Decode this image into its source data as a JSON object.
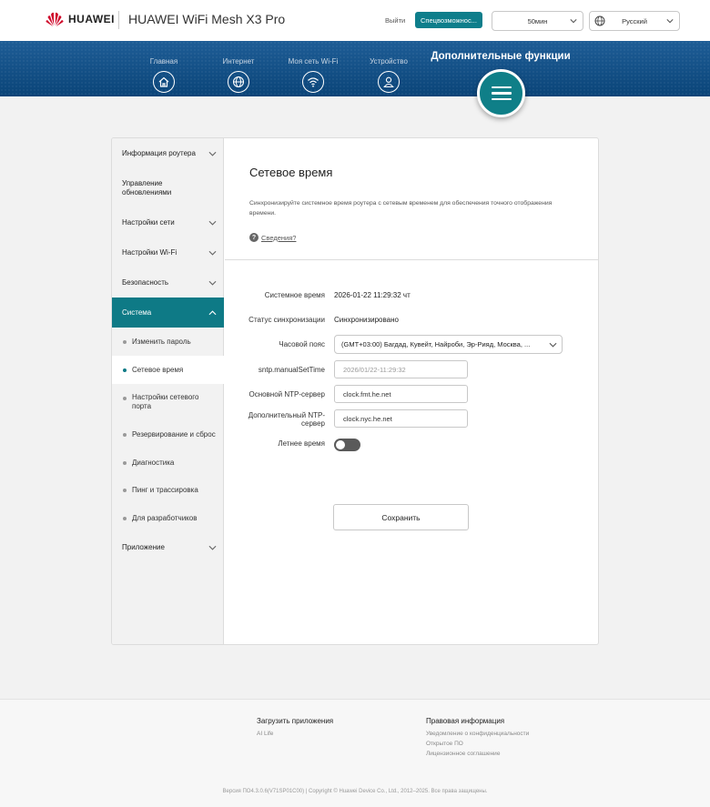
{
  "header": {
    "brand": "HUAWEI",
    "product": "HUAWEI WiFi Mesh X3 Pro",
    "logout_label": "Выйти",
    "accessibility_label": "Спецвозможнос...",
    "timeout_value": "50мин",
    "language_value": "Русский",
    "brand_color": "#cf0a2c",
    "accent_color": "#0e7e8b"
  },
  "nav": {
    "items": [
      {
        "label": "Главная",
        "icon": "home-icon"
      },
      {
        "label": "Интернет",
        "icon": "globe-icon"
      },
      {
        "label": "Моя сеть Wi-Fi",
        "icon": "wifi-icon"
      },
      {
        "label": "Устройство",
        "icon": "user-icon"
      }
    ],
    "active_label": "Дополнительные функции",
    "active_icon": "menu-icon"
  },
  "sidebar": {
    "items": [
      {
        "label": "Информация роутера"
      },
      {
        "label": "Управление обновлениями"
      },
      {
        "label": "Настройки сети"
      },
      {
        "label": "Настройки Wi-Fi"
      },
      {
        "label": "Безопасность"
      },
      {
        "label": "Система"
      },
      {
        "label": "Приложение"
      }
    ],
    "sub_items": [
      {
        "label": "Изменить пароль"
      },
      {
        "label": "Сетевое время"
      },
      {
        "label": "Настройки сетевого порта"
      },
      {
        "label": "Резервирование и сброс"
      },
      {
        "label": "Диагностика"
      },
      {
        "label": "Пинг и трассировка"
      },
      {
        "label": "Для разработчиков"
      }
    ]
  },
  "main": {
    "title": "Сетевое время",
    "description": "Синхронизируйте системное время роутера с сетевым временем для обеспечения точного отображения времени.",
    "help_link": "Сведения?",
    "fields": {
      "system_time_label": "Системное время",
      "system_time_value": "2026-01-22 11:29:32 чт",
      "sync_status_label": "Статус синхронизации",
      "sync_status_value": "Синхронизировано",
      "timezone_label": "Часовой пояс",
      "timezone_value": "(GMT+03:00) Багдад, Кувейт, Найроби, Эр-Рияд, Москва, ...",
      "manual_time_label": "sntp.manualSetTime",
      "manual_time_value": "2026/01/22-11:29:32",
      "primary_ntp_label": "Основной NTP-сервер",
      "primary_ntp_value": "clock.fmt.he.net",
      "secondary_ntp_label": "Дополнительный NTP-сервер",
      "secondary_ntp_value": "clock.nyc.he.net",
      "dst_label": "Летнее время",
      "dst_enabled": false
    },
    "save_label": "Сохранить"
  },
  "footer": {
    "apps_title": "Загрузить приложения",
    "apps_link": "AI Life",
    "legal_title": "Правовая информация",
    "legal_links": [
      "Уведомление о конфиденциальности",
      "Открытое ПО",
      "Лицензионное соглашение"
    ],
    "copyright": "Версия ПО4.3.0.6(V71SP01C00) | Copyright © Huawei Device Co., Ltd., 2012–2025. Все права защищены."
  }
}
